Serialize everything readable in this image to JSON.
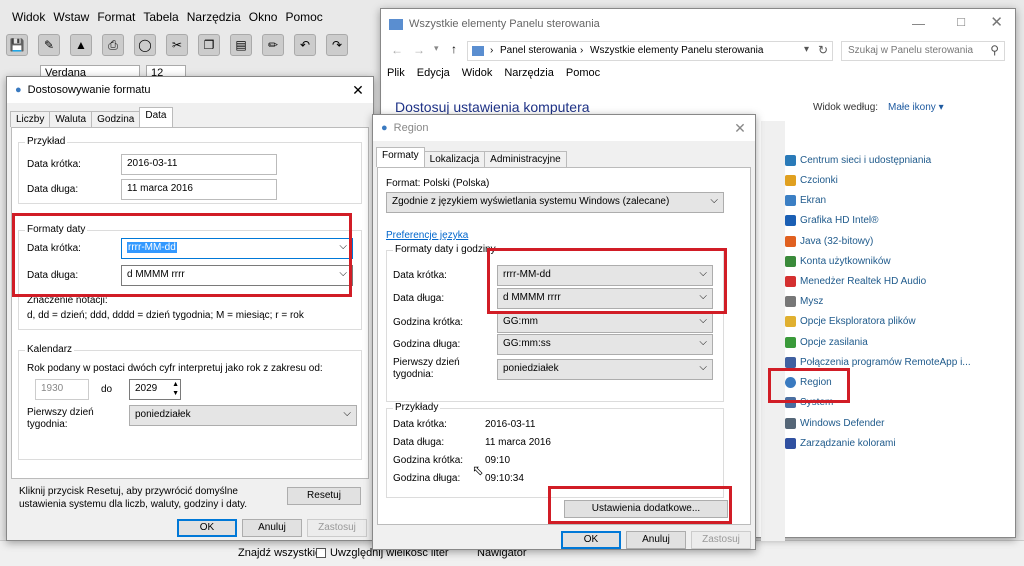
{
  "bg_app": {
    "menu": [
      "Widok",
      "Wstaw",
      "Format",
      "Tabela",
      "Narzędzia",
      "Okno",
      "Pomoc"
    ],
    "font": "Verdana",
    "font_size": "12",
    "find_all": "Znajdź wszystkie",
    "match_case": "Uwzględnij wielkość liter",
    "navigator": "Nawigator"
  },
  "fmt": {
    "title": "Dostosowywanie formatu",
    "tabs": [
      "Liczby",
      "Waluta",
      "Godzina",
      "Data"
    ],
    "example_group": "Przykład",
    "short_label": "Data krótka:",
    "short_value": "2016-03-11",
    "long_label": "Data długa:",
    "long_value": "11 marca 2016",
    "formats_group": "Formaty daty",
    "short_fmt": "rrrr-MM-dd",
    "long_fmt": "d MMMM rrrr",
    "notation_title": "Znaczenie notacji:",
    "notation": "d, dd = dzień;  ddd, dddd = dzień tygodnia;  M = miesiąc;  r = rok",
    "calendar_group": "Kalendarz",
    "two_digit_text": "Rok podany w postaci dwóch cyfr interpretuj jako rok z zakresu od:",
    "year_from": "1930",
    "to": "do",
    "year_to": "2029",
    "first_day_label": "Pierwszy dzień tygodnia:",
    "first_day": "poniedziałek",
    "reset_text": "Kliknij przycisk Resetuj, aby przywrócić domyślne ustawienia systemu dla liczb, waluty, godziny i daty.",
    "reset": "Resetuj",
    "ok": "OK",
    "cancel": "Anuluj",
    "apply": "Zastosuj"
  },
  "cp": {
    "title": "Wszystkie elementy Panelu sterowania",
    "crumb1": "Panel sterowania",
    "crumb2": "Wszystkie elementy Panelu sterowania",
    "search_placeholder": "Szukaj w Panelu sterowania",
    "menu": [
      "Plik",
      "Edycja",
      "Widok",
      "Narzędzia",
      "Pomoc"
    ],
    "heading": "Dostosuj ustawienia komputera",
    "view_by": "Widok według:",
    "view_mode": "Małe ikony",
    "items": [
      {
        "label": "Centrum sieci i udostępniania",
        "color": "#2a7ab8"
      },
      {
        "label": "Czcionki",
        "color": "#e0a020"
      },
      {
        "label": "Ekran",
        "color": "#3b7fc4"
      },
      {
        "label": "Grafika HD Intel®",
        "color": "#1a5fb4"
      },
      {
        "label": "Java (32-bitowy)",
        "color": "#e06020"
      },
      {
        "label": "Konta użytkowników",
        "color": "#3a8a3a"
      },
      {
        "label": "Menedżer Realtek HD Audio",
        "color": "#d43030"
      },
      {
        "label": "Mysz",
        "color": "#777777"
      },
      {
        "label": "Opcje Eksploratora plików",
        "color": "#e0b030"
      },
      {
        "label": "Opcje zasilania",
        "color": "#3a9a3a"
      },
      {
        "label": "Połączenia programów RemoteApp i...",
        "color": "#4060a0"
      },
      {
        "label": "Region",
        "color": "#3a7ac0"
      },
      {
        "label": "System",
        "color": "#4a6ea0"
      },
      {
        "label": "Windows Defender",
        "color": "#556677"
      },
      {
        "label": "Zarządzanie kolorami",
        "color": "#3050a0"
      }
    ]
  },
  "region": {
    "title": "Region",
    "tabs": [
      "Formaty",
      "Lokalizacja",
      "Administracyjne"
    ],
    "format_label": "Format: Polski (Polska)",
    "format_value": "Zgodnie z językiem wyświetlania systemu Windows (zalecane)",
    "pref_link": "Preferencje języka",
    "group1": "Formaty daty i godziny",
    "short_label": "Data krótka:",
    "short_value": "rrrr-MM-dd",
    "long_label": "Data długa:",
    "long_value": "d MMMM rrrr",
    "tshort_label": "Godzina krótka:",
    "tshort_value": "GG:mm",
    "tlong_label": "Godzina długa:",
    "tlong_value": "GG:mm:ss",
    "first_day_label": "Pierwszy dzień tygodnia:",
    "first_day": "poniedziałek",
    "examples": "Przykłady",
    "ex": [
      {
        "l": "Data krótka:",
        "v": "2016-03-11"
      },
      {
        "l": "Data długa:",
        "v": "11 marca 2016"
      },
      {
        "l": "Godzina krótka:",
        "v": "09:10"
      },
      {
        "l": "Godzina długa:",
        "v": "09:10:34"
      }
    ],
    "additional": "Ustawienia dodatkowe...",
    "ok": "OK",
    "cancel": "Anuluj",
    "apply": "Zastosuj"
  }
}
